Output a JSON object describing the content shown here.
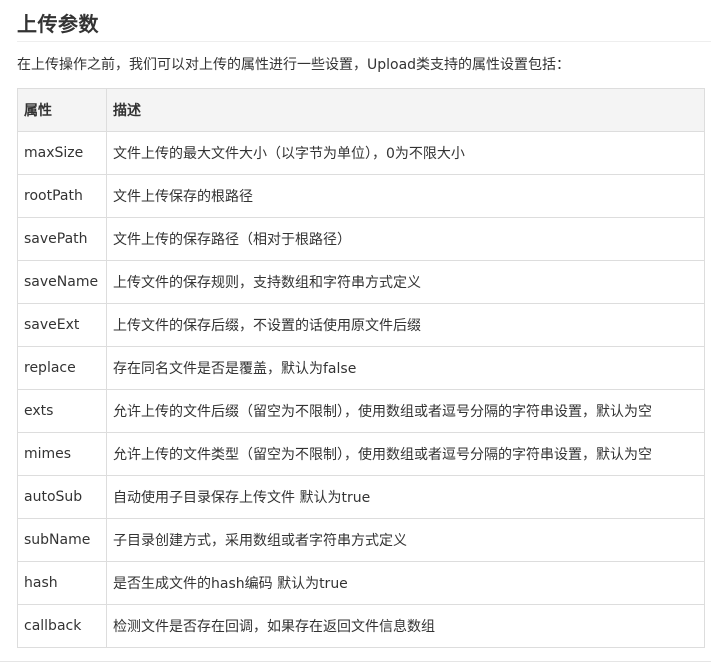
{
  "section": {
    "title": "上传参数",
    "intro": "在上传操作之前，我们可以对上传的属性进行一些设置，Upload类支持的属性设置包括："
  },
  "table": {
    "headers": [
      "属性",
      "描述"
    ],
    "rows": [
      {
        "name": "maxSize",
        "desc": "文件上传的最大文件大小（以字节为单位），0为不限大小"
      },
      {
        "name": "rootPath",
        "desc": "文件上传保存的根路径"
      },
      {
        "name": "savePath",
        "desc": "文件上传的保存路径（相对于根路径）"
      },
      {
        "name": "saveName",
        "desc": "上传文件的保存规则，支持数组和字符串方式定义"
      },
      {
        "name": "saveExt",
        "desc": "上传文件的保存后缀，不设置的话使用原文件后缀"
      },
      {
        "name": "replace",
        "desc": "存在同名文件是否是覆盖，默认为false"
      },
      {
        "name": "exts",
        "desc": "允许上传的文件后缀（留空为不限制），使用数组或者逗号分隔的字符串设置，默认为空"
      },
      {
        "name": "mimes",
        "desc": "允许上传的文件类型（留空为不限制），使用数组或者逗号分隔的字符串设置，默认为空"
      },
      {
        "name": "autoSub",
        "desc": "自动使用子目录保存上传文件 默认为true"
      },
      {
        "name": "subName",
        "desc": "子目录创建方式，采用数组或者字符串方式定义"
      },
      {
        "name": "hash",
        "desc": "是否生成文件的hash编码 默认为true"
      },
      {
        "name": "callback",
        "desc": "检测文件是否存在回调，如果存在返回文件信息数组"
      }
    ]
  }
}
